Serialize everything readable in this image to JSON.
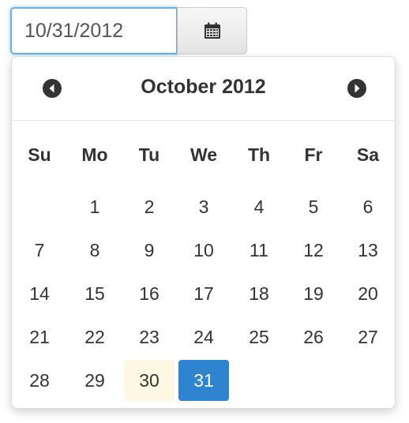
{
  "input": {
    "value": "10/31/2012"
  },
  "calendar_button": {
    "icon": "calendar-icon"
  },
  "calendar": {
    "title": "October 2012",
    "prev_icon": "chevron-circle-left-icon",
    "next_icon": "chevron-circle-right-icon",
    "days_of_week": [
      "Su",
      "Mo",
      "Tu",
      "We",
      "Th",
      "Fr",
      "Sa"
    ],
    "weeks": [
      [
        "",
        "1",
        "2",
        "3",
        "4",
        "5",
        "6"
      ],
      [
        "7",
        "8",
        "9",
        "10",
        "11",
        "12",
        "13"
      ],
      [
        "14",
        "15",
        "16",
        "17",
        "18",
        "19",
        "20"
      ],
      [
        "21",
        "22",
        "23",
        "24",
        "25",
        "26",
        "27"
      ],
      [
        "28",
        "29",
        "30",
        "31",
        "",
        "",
        ""
      ]
    ],
    "today": "30",
    "selected": "31",
    "colors": {
      "selected": "#2f84d0",
      "today": "#fcf8e3",
      "focus_border": "#66afe9"
    }
  }
}
